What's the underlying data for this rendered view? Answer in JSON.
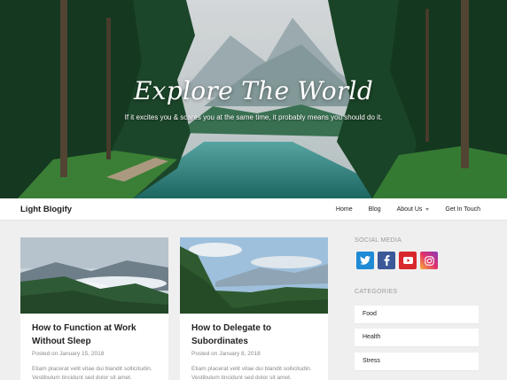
{
  "hero": {
    "title": "Explore The World",
    "subtitle": "If it excites you & scares you at the same time, it probably means you should do it."
  },
  "navbar": {
    "brand": "Light Blogify",
    "items": [
      {
        "label": "Home"
      },
      {
        "label": "Blog"
      },
      {
        "label": "About Us",
        "has_dropdown": true
      },
      {
        "label": "Get In Touch"
      }
    ]
  },
  "posts": [
    {
      "title": "How to Function at Work Without Sleep",
      "date": "Posted on January 15, 2018",
      "excerpt": "Etiam placerat velit vitae dui blandit sollicitudin. Vestibulum tincidunt sed dolor sit amet."
    },
    {
      "title": "How to Delegate to Subordinates",
      "date": "Posted on January 8, 2018",
      "excerpt": "Etiam placerat velit vitae dui blandit sollicitudin. Vestibulum tincidunt sed dolor sit amet."
    }
  ],
  "sidebar": {
    "social_heading": "SOCIAL MEDIA",
    "socials": [
      {
        "icon": "twitter-icon",
        "color": "#1f8ad6"
      },
      {
        "icon": "facebook-icon",
        "color": "#3b5998"
      },
      {
        "icon": "youtube-icon",
        "color": "#d8282c"
      },
      {
        "icon": "instagram-icon",
        "color": "#e1306c"
      }
    ],
    "categories_heading": "CATEGORIES",
    "categories": [
      {
        "label": "Food"
      },
      {
        "label": "Health"
      },
      {
        "label": "Stress"
      }
    ]
  }
}
